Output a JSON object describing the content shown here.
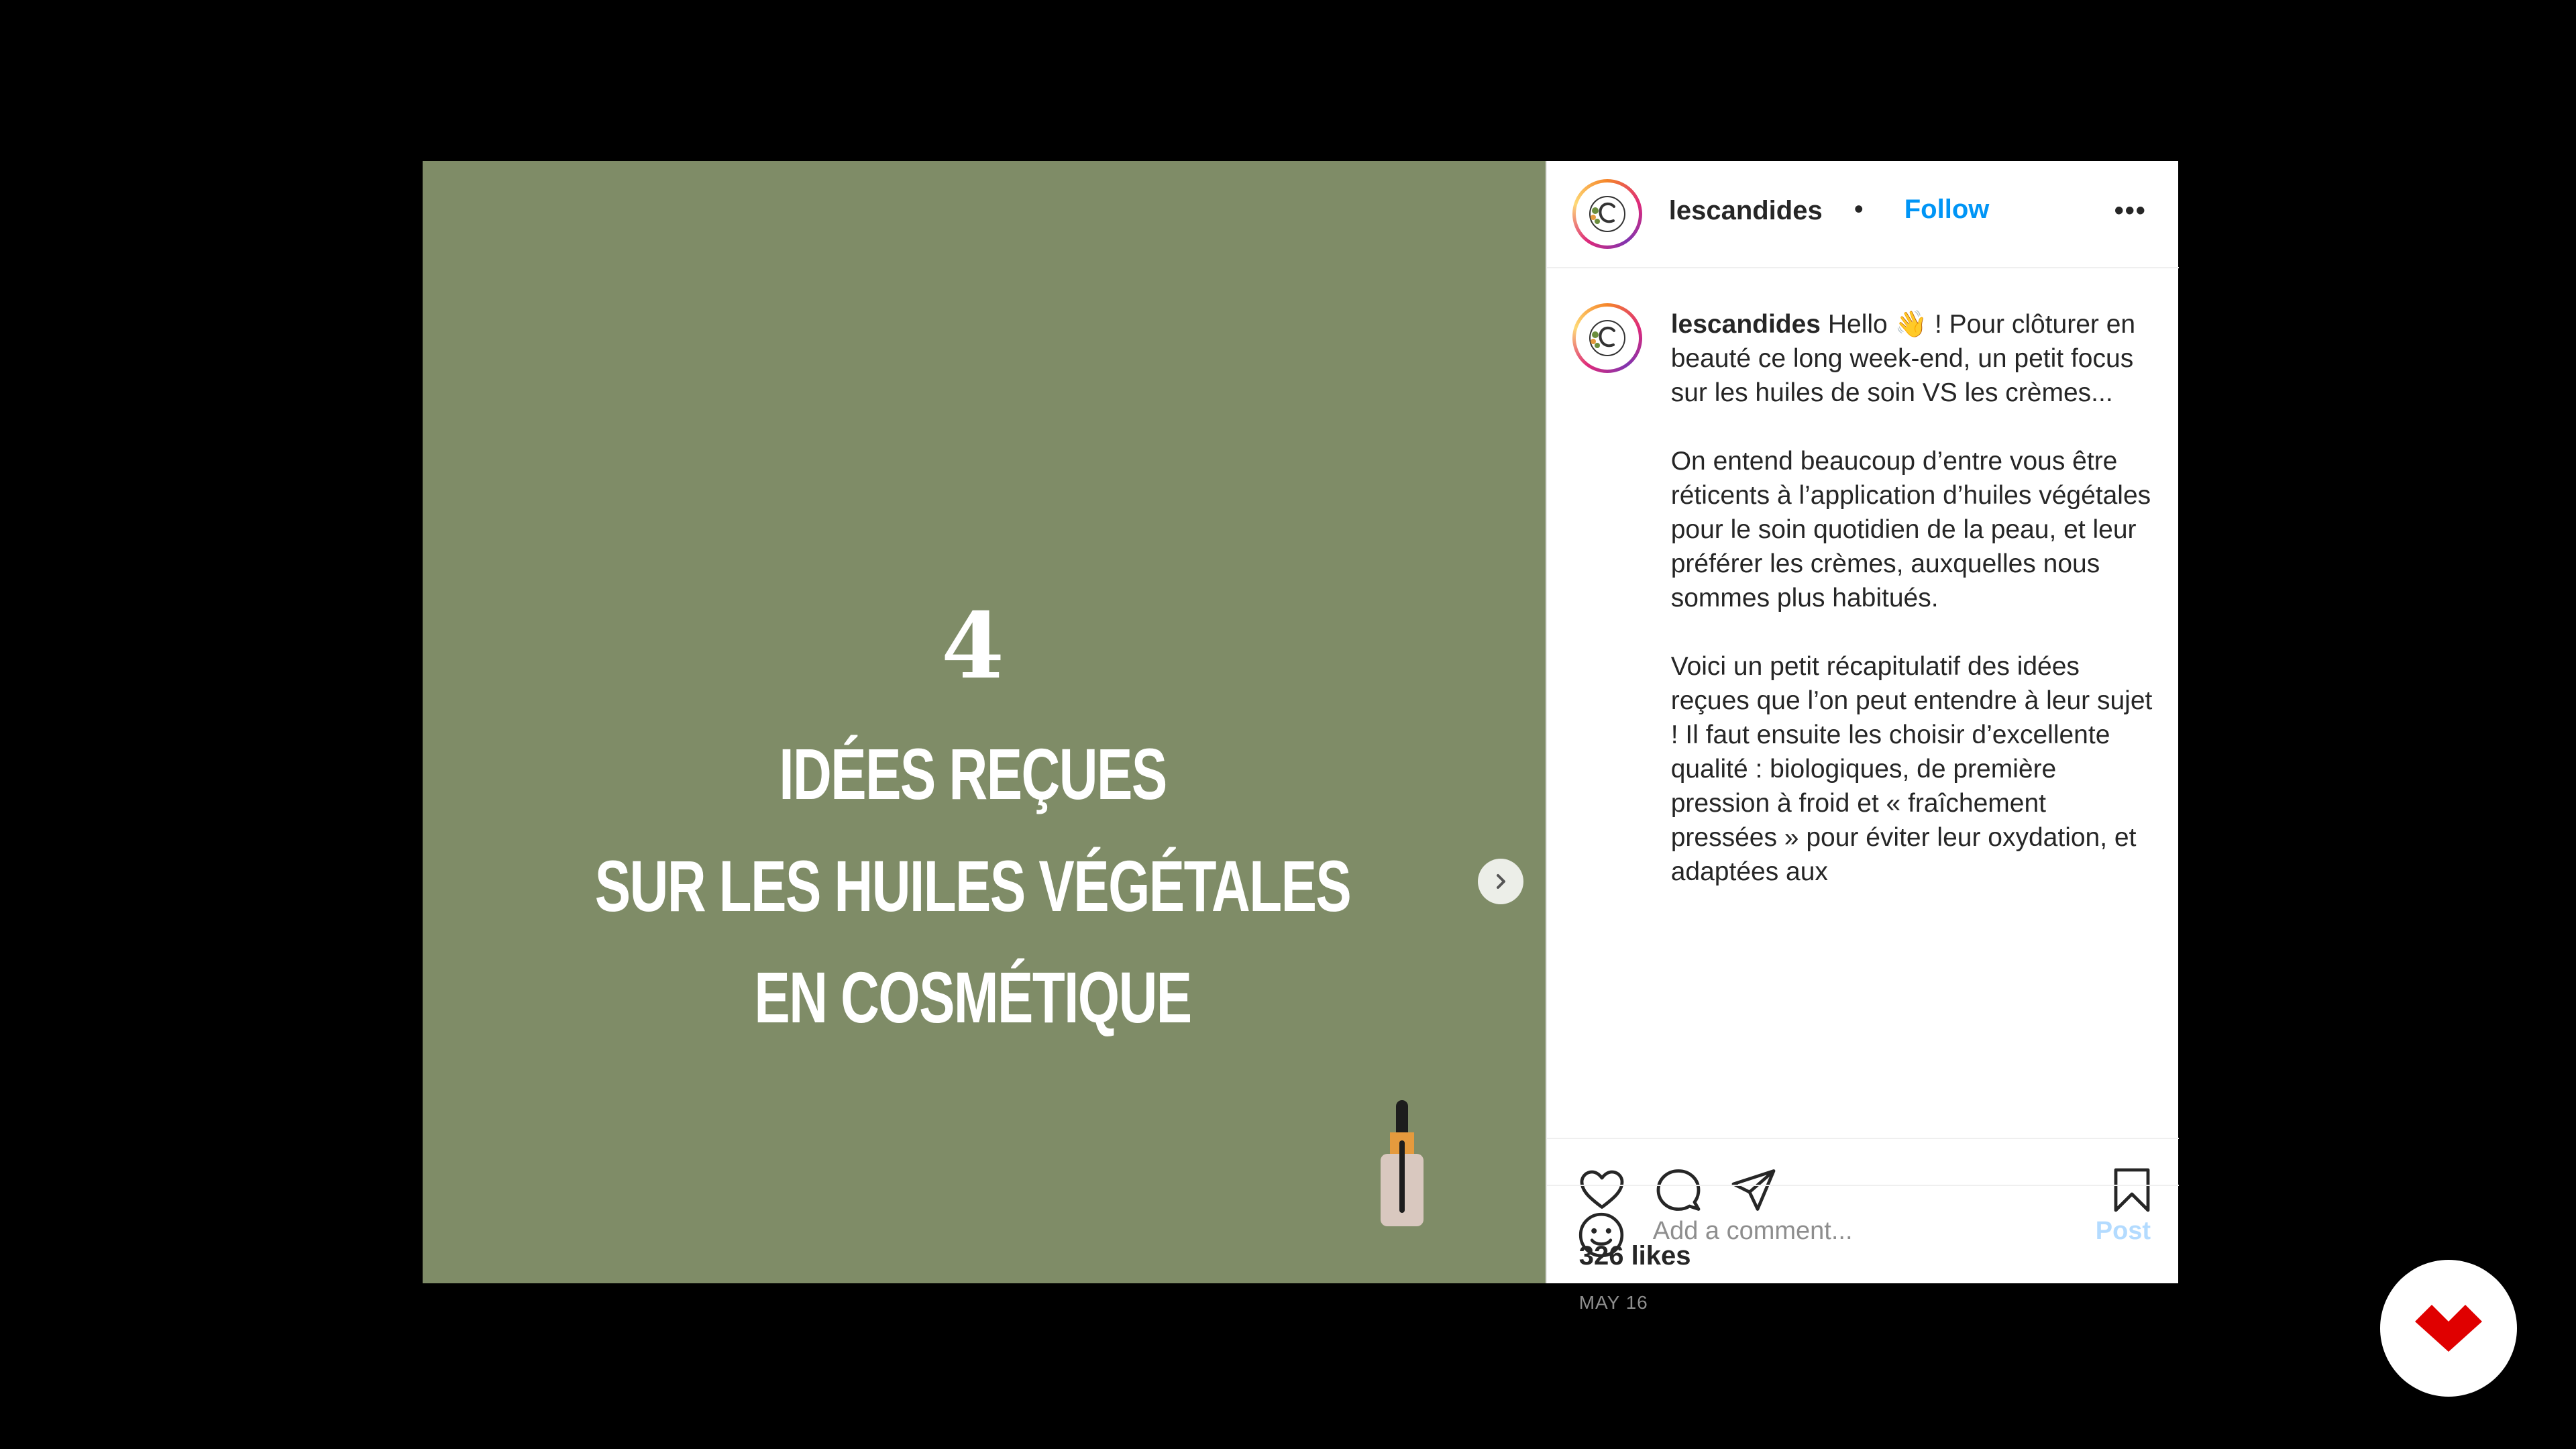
{
  "slide": {
    "number": "4",
    "lines": [
      "IDÉES REÇUES",
      "SUR LES HUILES VÉGÉTALES",
      "EN COSMÉTIQUE"
    ],
    "background_color": "#7f8c67",
    "dots_total": 5,
    "dots_active_index": 0
  },
  "header": {
    "username": "lescandides",
    "separator": "•",
    "follow_label": "Follow",
    "more_label": "•••"
  },
  "caption": {
    "username": "lescandides",
    "paragraphs": [
      "Hello 👋 ! Pour clôturer en beauté ce long week-end, un petit focus sur les huiles de soin VS les crèmes...",
      "On entend beaucoup d’entre vous être réticents à l’application d’huiles végétales pour le soin quotidien de la peau, et leur préférer les crèmes, auxquelles nous sommes plus habitués.",
      "Voici un petit récapitulatif des idées reçues que l’on peut entendre à leur sujet ! Il faut ensuite les choisir d’excellente qualité : biologiques, de première pression à froid et « fraîchement pressées » pour éviter leur oxydation, et adaptées aux"
    ]
  },
  "engagement": {
    "likes": "326 likes",
    "date": "MAY 16"
  },
  "comment": {
    "placeholder": "Add a comment...",
    "post_label": "Post"
  },
  "icons": {
    "like": "heart-icon",
    "comment": "comment-icon",
    "share": "paper-plane-icon",
    "save": "bookmark-icon",
    "emoji": "smiley-icon",
    "next": "chevron-right-icon",
    "brand": "brand-logo-icon"
  },
  "colors": {
    "link": "#0095f6",
    "post_disabled": "#b3dbff",
    "brand_red": "#e00000"
  }
}
